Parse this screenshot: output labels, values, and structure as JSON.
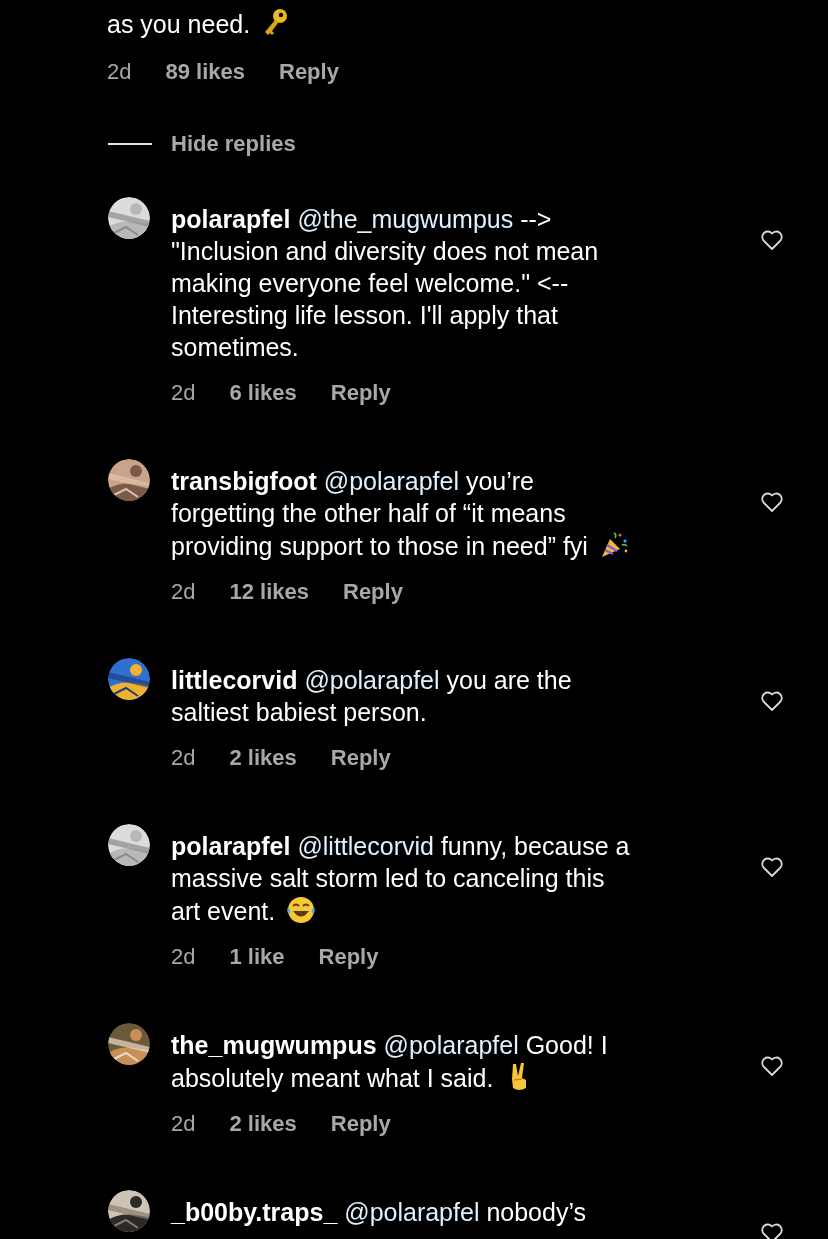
{
  "parent_comment": {
    "text": "as you need.",
    "icon": {
      "kind": "key"
    },
    "time": "2d",
    "likes": "89 likes",
    "reply": "Reply"
  },
  "hide_replies": "Hide replies",
  "comments": [
    {
      "username": "polarapfel",
      "mention": "@the_mugwumpus",
      "text": "-->\n\"Inclusion and diversity does not mean\nmaking everyone feel welcome.\" <--\nInteresting life lesson. I'll apply that\nsometimes.",
      "time": "2d",
      "likes": "6 likes",
      "reply": "Reply",
      "liked": false
    },
    {
      "username": "transbigfoot",
      "mention": "@polarapfel",
      "text": "you’re\nforgetting the other half of “it means\nproviding support to those in need” fyi",
      "icon": {
        "kind": "party"
      },
      "time": "2d",
      "likes": "12 likes",
      "reply": "Reply",
      "liked": false
    },
    {
      "username": "littlecorvid",
      "mention": "@polarapfel",
      "text": "you are the\nsaltiest babiest person.",
      "time": "2d",
      "likes": "2 likes",
      "reply": "Reply",
      "liked": false
    },
    {
      "username": "polarapfel",
      "mention": "@littlecorvid",
      "text": "funny, because a\nmassive salt storm led to canceling this\nart event.",
      "icon": {
        "kind": "laugh"
      },
      "time": "2d",
      "likes": "1 like",
      "reply": "Reply",
      "liked": false
    },
    {
      "username": "the_mugwumpus",
      "mention": "@polarapfel",
      "text": "Good! I\nabsolutely meant what I said.",
      "icon": {
        "kind": "peace"
      },
      "time": "2d",
      "likes": "2 likes",
      "reply": "Reply",
      "liked": false
    },
    {
      "username": "_b00by.traps_",
      "mention": "@polarapfel",
      "text": "nobody’s",
      "liked": false
    }
  ]
}
